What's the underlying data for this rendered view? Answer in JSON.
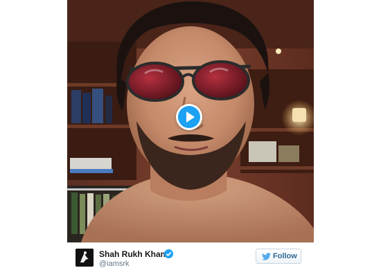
{
  "tweet": {
    "author_name": "Shah Rukh Khan",
    "author_handle": "@iamsrk",
    "verified": true,
    "follow_label": "Follow"
  },
  "video": {
    "play_icon": "play-icon",
    "accent_color": "#1da1f2"
  },
  "icons": {
    "verified": "verified-badge-icon",
    "follow": "twitter-bird-icon"
  }
}
